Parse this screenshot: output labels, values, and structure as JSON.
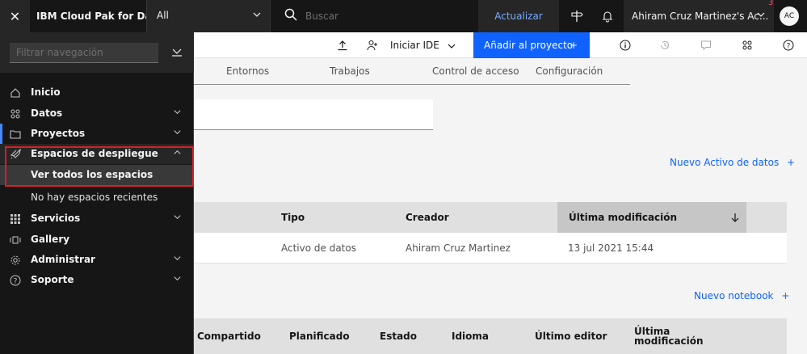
{
  "topbar": {
    "close_label": "✕",
    "brand": "IBM Cloud Pak for Data",
    "scope_value": "All",
    "search_placeholder": "Buscar",
    "update_label": "Actualizar",
    "account_name": "Ahiram Cruz Martinez's Ac...",
    "notification_count": "3",
    "avatar_initials": "AC"
  },
  "sidenav": {
    "filter_placeholder": "Filtrar navegación",
    "items": [
      {
        "label": "Inicio",
        "icon": "home-icon"
      },
      {
        "label": "Datos",
        "icon": "data-icon"
      },
      {
        "label": "Proyectos",
        "icon": "folder-icon"
      },
      {
        "label": "Espacios de despliegue",
        "icon": "rocket-icon"
      },
      {
        "label": "Servicios",
        "icon": "grid-icon"
      },
      {
        "label": "Gallery",
        "icon": "gallery-icon"
      },
      {
        "label": "Administrar",
        "icon": "settings-icon"
      },
      {
        "label": "Soporte",
        "icon": "help-icon"
      }
    ],
    "sub_current": "Ver todos los espacios",
    "sub_empty": "No hay espacios recientes"
  },
  "toolbar": {
    "ide_label": "Iniciar IDE",
    "add_label": "Añadir al proyecto",
    "add_plus": "+"
  },
  "tabs": [
    "Entornos",
    "Trabajos",
    "Control de acceso",
    "Configuración"
  ],
  "data_assets": {
    "new_link": "Nuevo Activo de datos",
    "columns": [
      "Tipo",
      "Creador",
      "Última modificación"
    ],
    "rows": [
      {
        "type": "Activo de datos",
        "creator": "Ahiram Cruz Martinez",
        "modified": "13 jul 2021 15:44"
      }
    ]
  },
  "notebooks": {
    "new_link": "Nuevo notebook",
    "columns": [
      "Compartido",
      "Planificado",
      "Estado",
      "Idioma",
      "Último editor",
      "Última modificación"
    ]
  },
  "colors": {
    "topbar_bg": "#161616",
    "accent": "#0f62fe",
    "highlight": "#da1e28",
    "active_marker": "#4589ff"
  }
}
